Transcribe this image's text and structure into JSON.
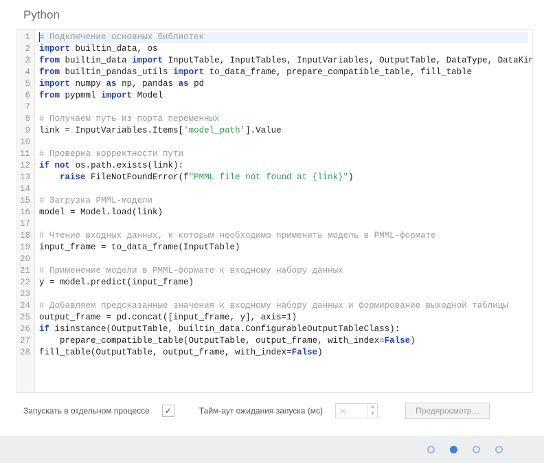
{
  "title": "Python",
  "code": {
    "lines": [
      {
        "n": 1,
        "hl": true,
        "tokens": [
          {
            "t": "# Подключение основных библиотек",
            "c": "c-comment",
            "cursor": true
          }
        ]
      },
      {
        "n": 2,
        "tokens": [
          {
            "t": "import",
            "c": "c-kw"
          },
          {
            "t": " builtin_data, os",
            "c": "c-txt"
          }
        ]
      },
      {
        "n": 3,
        "tokens": [
          {
            "t": "from",
            "c": "c-kw"
          },
          {
            "t": " builtin_data ",
            "c": "c-txt"
          },
          {
            "t": "import",
            "c": "c-kw"
          },
          {
            "t": " InputTable, InputTables, InputVariables, OutputTable, DataType, DataKind, UsageType",
            "c": "c-txt"
          }
        ]
      },
      {
        "n": 4,
        "tokens": [
          {
            "t": "from",
            "c": "c-kw"
          },
          {
            "t": " builtin_pandas_utils ",
            "c": "c-txt"
          },
          {
            "t": "import",
            "c": "c-kw"
          },
          {
            "t": " to_data_frame, prepare_compatible_table, fill_table",
            "c": "c-txt"
          }
        ]
      },
      {
        "n": 5,
        "tokens": [
          {
            "t": "import",
            "c": "c-kw"
          },
          {
            "t": " numpy ",
            "c": "c-txt"
          },
          {
            "t": "as",
            "c": "c-kw"
          },
          {
            "t": " np, pandas ",
            "c": "c-txt"
          },
          {
            "t": "as",
            "c": "c-kw"
          },
          {
            "t": " pd",
            "c": "c-txt"
          }
        ]
      },
      {
        "n": 6,
        "tokens": [
          {
            "t": "from",
            "c": "c-kw"
          },
          {
            "t": " pypmml ",
            "c": "c-txt"
          },
          {
            "t": "import",
            "c": "c-kw"
          },
          {
            "t": " Model",
            "c": "c-txt"
          }
        ]
      },
      {
        "n": 7,
        "tokens": []
      },
      {
        "n": 8,
        "tokens": [
          {
            "t": "# Получаем путь из порта переменных",
            "c": "c-comment"
          }
        ]
      },
      {
        "n": 9,
        "tokens": [
          {
            "t": "link = InputVariables.Items[",
            "c": "c-txt"
          },
          {
            "t": "'model_path'",
            "c": "c-str"
          },
          {
            "t": "].Value",
            "c": "c-txt"
          }
        ]
      },
      {
        "n": 10,
        "tokens": []
      },
      {
        "n": 11,
        "tokens": [
          {
            "t": "# Проверка корректности пути",
            "c": "c-comment"
          }
        ]
      },
      {
        "n": 12,
        "tokens": [
          {
            "t": "if",
            "c": "c-kw"
          },
          {
            "t": " ",
            "c": "c-txt"
          },
          {
            "t": "not",
            "c": "c-kw"
          },
          {
            "t": " os.path.exists(link):",
            "c": "c-txt"
          }
        ]
      },
      {
        "n": 13,
        "tokens": [
          {
            "t": "    ",
            "c": "c-txt"
          },
          {
            "t": "raise",
            "c": "c-kw"
          },
          {
            "t": " FileNotFoundError(f",
            "c": "c-txt"
          },
          {
            "t": "\"PMML file not found at {link}\"",
            "c": "c-str"
          },
          {
            "t": ")",
            "c": "c-txt"
          }
        ]
      },
      {
        "n": 14,
        "tokens": []
      },
      {
        "n": 15,
        "tokens": [
          {
            "t": "# Загрузка PMML-модели",
            "c": "c-comment"
          }
        ]
      },
      {
        "n": 16,
        "tokens": [
          {
            "t": "model = Model.load(link)",
            "c": "c-txt"
          }
        ]
      },
      {
        "n": 17,
        "tokens": []
      },
      {
        "n": 18,
        "tokens": [
          {
            "t": "# Чтение входных данных, к которым необходимо применить модель в PMML-формате",
            "c": "c-comment"
          }
        ]
      },
      {
        "n": 19,
        "tokens": [
          {
            "t": "input_frame = to_data_frame(InputTable)",
            "c": "c-txt"
          }
        ]
      },
      {
        "n": 20,
        "tokens": []
      },
      {
        "n": 21,
        "tokens": [
          {
            "t": "# Применение модели в PMML-формате к входному набору данных",
            "c": "c-comment"
          }
        ]
      },
      {
        "n": 22,
        "tokens": [
          {
            "t": "y = model.predict(input_frame)",
            "c": "c-txt"
          }
        ]
      },
      {
        "n": 23,
        "tokens": []
      },
      {
        "n": 24,
        "tokens": [
          {
            "t": "# Добавляем предсказанные значения к входному набору данных и формирование выходной таблицы",
            "c": "c-comment"
          }
        ]
      },
      {
        "n": 25,
        "tokens": [
          {
            "t": "output_frame = pd.concat([input_frame, y], axis=1)",
            "c": "c-txt"
          }
        ]
      },
      {
        "n": 26,
        "tokens": [
          {
            "t": "if",
            "c": "c-kw"
          },
          {
            "t": " isinstance(OutputTable, builtin_data.ConfigurableOutputTableClass):",
            "c": "c-txt"
          }
        ]
      },
      {
        "n": 27,
        "tokens": [
          {
            "t": "    prepare_compatible_table(OutputTable, output_frame, with_index=",
            "c": "c-txt"
          },
          {
            "t": "False",
            "c": "c-kw"
          },
          {
            "t": ")",
            "c": "c-txt"
          }
        ]
      },
      {
        "n": 28,
        "tokens": [
          {
            "t": "fill_table(OutputTable, output_frame, with_index=",
            "c": "c-txt"
          },
          {
            "t": "False",
            "c": "c-kw"
          },
          {
            "t": ")",
            "c": "c-txt"
          }
        ]
      }
    ]
  },
  "footer": {
    "run_separate_label": "Запускать в отдельном процессе",
    "run_separate_checked": "✓",
    "timeout_label": "Тайм-аут ожидания запуска (мс)",
    "timeout_value": "∞",
    "preview_label": "Предпросмотр…"
  },
  "pager": {
    "count": 4,
    "active": 1
  }
}
